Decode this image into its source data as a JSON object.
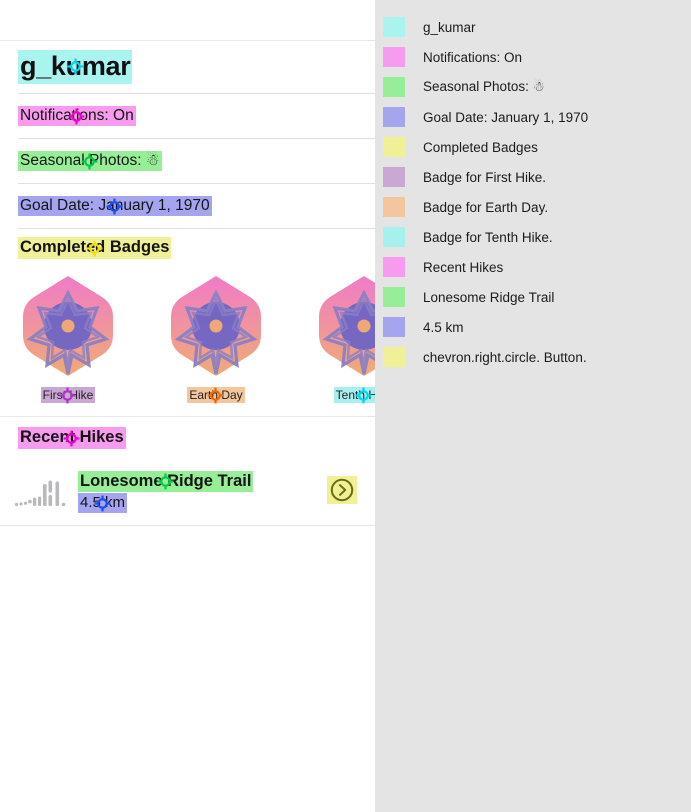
{
  "app": {
    "profile_name": "g_kumar",
    "notifications": "Notifications: On",
    "seasonal_photos": "Seasonal Photos: ☃",
    "goal_date": "Goal Date: January 1, 1970",
    "badges_header": "Completed Badges",
    "recent_header": "Recent Hikes"
  },
  "badges": [
    {
      "label": "First Hike",
      "highlight": "#c9a8d4"
    },
    {
      "label": "Earth Day",
      "highlight": "#f3c79b"
    },
    {
      "label": "Tenth Hike",
      "highlight": "#a8f0ee"
    }
  ],
  "hike": {
    "title": "Lonesome Ridge Trail",
    "distance": "4.5 km",
    "chevron_name": "chevron.right.circle. Button."
  },
  "highlights": {
    "cyan": "#aaf4f0",
    "magenta": "#f79bee",
    "green": "#96ee96",
    "periwinkle": "#a5a5ef",
    "yellow": "#f0f096",
    "purple": "#c9a8d4",
    "orange": "#f3c79b",
    "pink": "#f79bee"
  },
  "markers": {
    "title": "#00d8e8",
    "notifications": "#ee00cc",
    "seasonal": "#00cc44",
    "goal": "#1a4df0",
    "badges_header": "#f0e000",
    "badge_first": "#b033c9",
    "badge_earth": "#f06800",
    "badge_tenth": "#00d8e8",
    "recent_header": "#ee00cc",
    "hike_title": "#00cc44",
    "hike_distance": "#1a4df0"
  },
  "badge_art": {
    "gradient_top": "#f07bc8",
    "gradient_bottom": "#efac74",
    "core": "#6b63c6",
    "star_stroke": "#8a7fc4",
    "center_dot": "#f0a875"
  },
  "legend": {
    "items": [
      {
        "color": "#aaf4f0",
        "label": "g_kumar"
      },
      {
        "color": "#f79bee",
        "label": "Notifications: On"
      },
      {
        "color": "#96ee96",
        "label": "Seasonal Photos: ☃"
      },
      {
        "color": "#a5a5ef",
        "label": "Goal Date: January 1, 1970"
      },
      {
        "color": "#f0f096",
        "label": "Completed Badges"
      },
      {
        "color": "#c9a8d4",
        "label": "Badge for First Hike."
      },
      {
        "color": "#f3c79b",
        "label": "Badge for Earth Day."
      },
      {
        "color": "#a8f0ee",
        "label": "Badge for Tenth Hike."
      },
      {
        "color": "#f79bee",
        "label": "Recent Hikes"
      },
      {
        "color": "#96ee96",
        "label": "Lonesome Ridge Trail"
      },
      {
        "color": "#a5a5ef",
        "label": "4.5 km"
      },
      {
        "color": "#f0f096",
        "label": "chevron.right.circle. Button."
      }
    ]
  }
}
